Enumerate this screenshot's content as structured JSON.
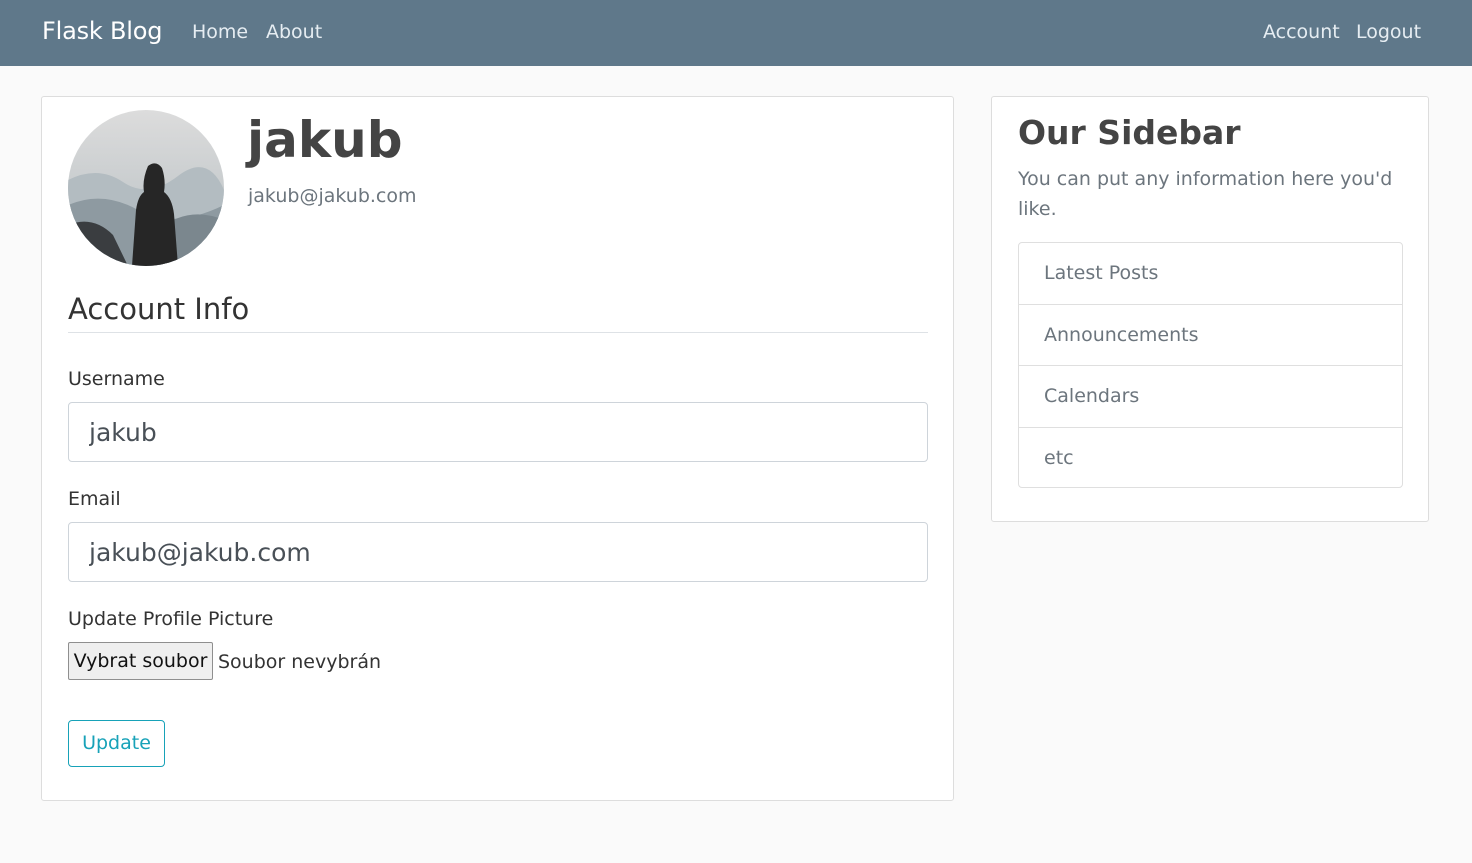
{
  "navbar": {
    "brand": "Flask Blog",
    "left_links": [
      "Home",
      "About"
    ],
    "right_links": [
      "Account",
      "Logout"
    ],
    "color": "#5f788a"
  },
  "profile": {
    "username": "jakub",
    "email": "jakub@jakub.com",
    "avatar_icon": "profile-photo"
  },
  "form": {
    "legend": "Account Info",
    "username_label": "Username",
    "username_value": "jakub",
    "email_label": "Email",
    "email_value": "jakub@jakub.com",
    "picture_label": "Update Profile Picture",
    "file_button": "Vybrat soubor",
    "file_status": "Soubor nevybrán",
    "submit": "Update",
    "accent": "#17a2b8"
  },
  "sidebar": {
    "title": "Our Sidebar",
    "description": "You can put any information here you'd like.",
    "items": [
      "Latest Posts",
      "Announcements",
      "Calendars",
      "etc"
    ]
  }
}
